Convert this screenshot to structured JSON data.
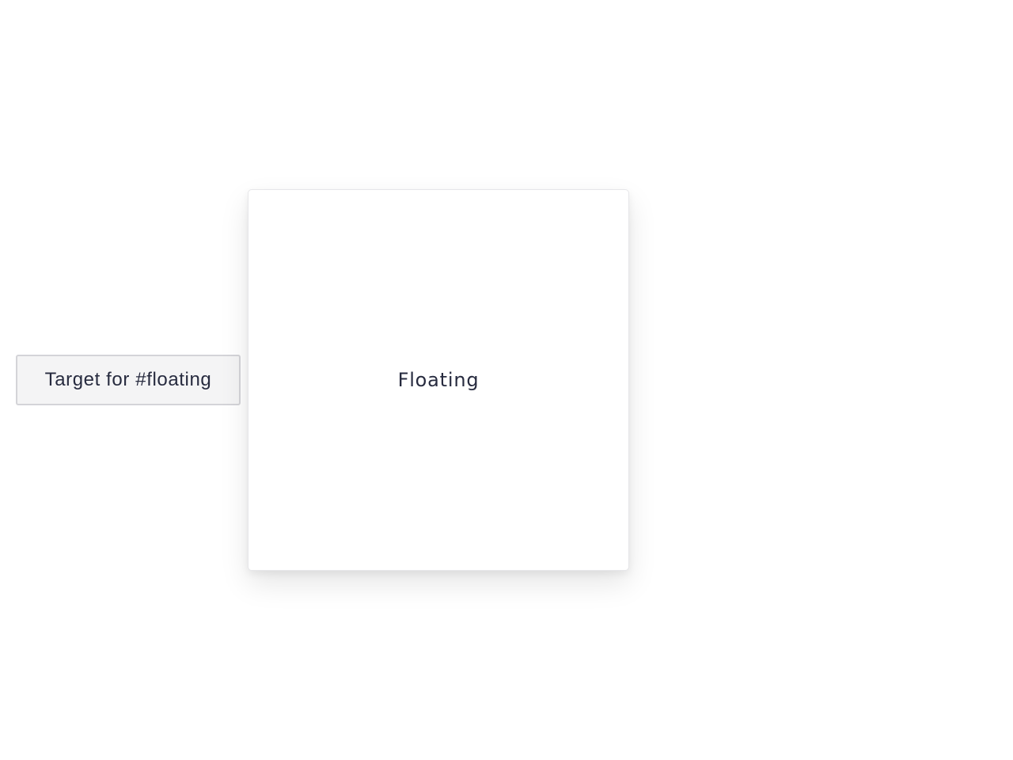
{
  "target": {
    "label": "Target for #floating"
  },
  "floating": {
    "label": "Floating"
  },
  "colors": {
    "background": "#ffffff",
    "text": "#272b3f",
    "button_bg": "#f4f4f5",
    "button_border": "#d4d4d8",
    "panel_border": "#e6e6e9"
  }
}
